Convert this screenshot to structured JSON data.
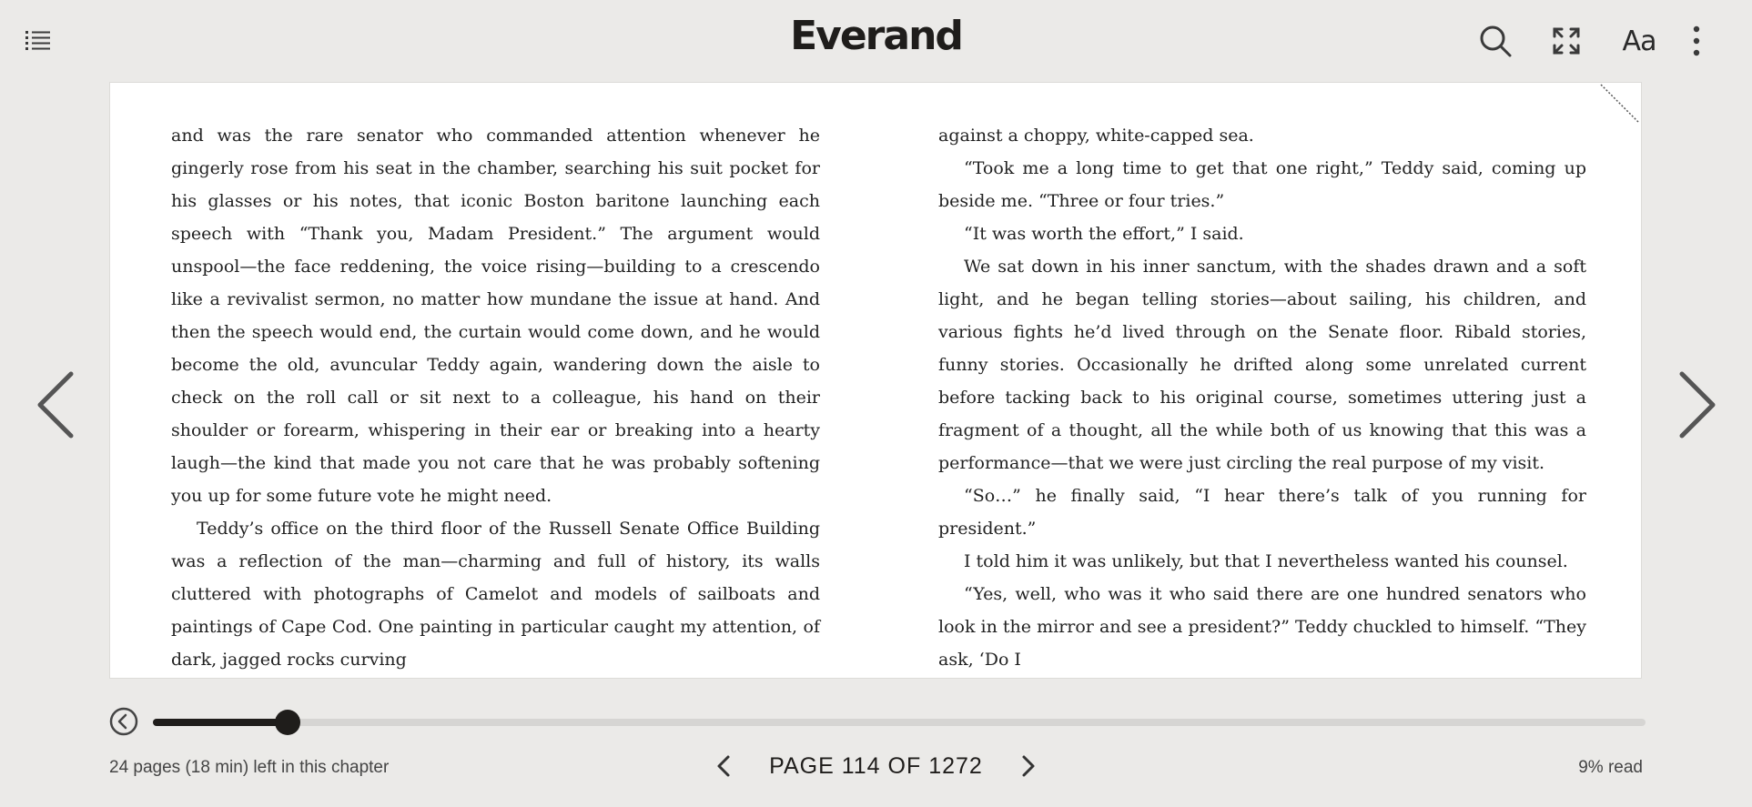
{
  "header": {
    "logo": "Everand",
    "font_button_label": "Aa",
    "icons": [
      "list-icon",
      "search-icon",
      "fullscreen-icon",
      "font-settings-icon",
      "more-vertical-icon"
    ]
  },
  "reader": {
    "left_column": [
      {
        "text": "and was the rare senator who commanded attention whenever he gingerly rose from his seat in the chamber, searching his suit pocket for his glasses or his notes, that iconic Boston baritone launching each speech with “Thank you, Madam President.” The argument would unspool—the face reddening, the voice rising—building to a crescendo like a revivalist sermon, no matter how mundane the issue at hand. And then the speech would end, the curtain would come down, and he would become the old, avuncular Teddy again, wandering down the aisle to check on the roll call or sit next to a colleague, his hand on their shoulder or forearm, whispering in their ear or breaking into a hearty laugh—the kind that made you not care that he was probably softening you up for some future vote he might need.",
        "indent": false
      },
      {
        "text": "Teddy’s office on the third floor of the Russell Senate Office Building was a reflection of the man—charming and full of history, its walls cluttered with photographs of Camelot and models of sailboats and paintings of Cape Cod. One painting in particular caught my attention, of dark, jagged rocks curving",
        "indent": true
      }
    ],
    "right_column": [
      {
        "text": "against a choppy, white-capped sea.",
        "indent": false
      },
      {
        "text": "“Took me a long time to get that one right,” Teddy said, coming up beside me. “Three or four tries.”",
        "indent": true
      },
      {
        "text": "“It was worth the effort,” I said.",
        "indent": true
      },
      {
        "text": "We sat down in his inner sanctum, with the shades drawn and a soft light, and he began telling stories—about sailing, his children, and various fights he’d lived through on the Senate floor. Ribald stories, funny stories. Occasionally he drifted along some unrelated current before tacking back to his original course, sometimes uttering just a fragment of a thought, all the while both of us knowing that this was a performance—that we were just circling the real purpose of my visit.",
        "indent": true
      },
      {
        "text": "“So…” he finally said, “I hear there’s talk of you running for president.”",
        "indent": true
      },
      {
        "text": "I told him it was unlikely, but that I nevertheless wanted his counsel.",
        "indent": true
      },
      {
        "text": "“Yes, well, who was it who said there are one hundred senators who look in the mirror and see a president?” Teddy chuckled to himself. “They ask, ‘Do I",
        "indent": true
      }
    ]
  },
  "footer": {
    "chapter_remaining": "24 pages (18 min) left in this chapter",
    "page_label": "PAGE 114 OF 1272",
    "percent_read": "9% read",
    "progress_fraction": 0.09
  },
  "colors": {
    "background": "#ebeae8",
    "page": "#ffffff",
    "accent": "#1f1d1b",
    "track": "#d6d5d3"
  }
}
